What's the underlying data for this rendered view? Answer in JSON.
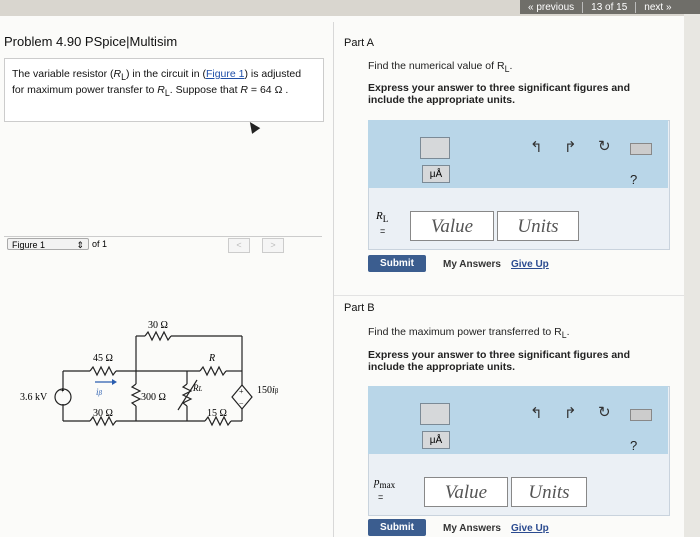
{
  "nav": {
    "previous": "« previous",
    "position": "13 of 15",
    "next": "next »"
  },
  "problem": {
    "title": "Problem 4.90 PSpice|Multisim",
    "text_a": "The variable resistor (",
    "text_rl": "R",
    "text_rl_sub": "L",
    "text_b": ") in the circuit in (",
    "figure_link": "Figure 1",
    "text_c": ") is adjusted for maximum power transfer to ",
    "text_d": ". Suppose that ",
    "text_r": "R",
    "text_e": " = 64  Ω ."
  },
  "figure": {
    "label": "Figure 1",
    "of": "of 1",
    "prev": "<",
    "next": ">"
  },
  "circuit": {
    "r_top": "30 Ω",
    "r_45": "45 Ω",
    "r_R": "R",
    "r_30": "30 Ω",
    "r_300": "300 Ω",
    "r_L": "R",
    "r_L_sub": "L",
    "r_15": "15 Ω",
    "source_v": "3.6 kV",
    "i_label": "i",
    "i_sub": "β",
    "dep_source": "150",
    "dep_sub": "β"
  },
  "partA": {
    "header": "Part A",
    "prompt": "Find the numerical value of R",
    "prompt_sub": "L",
    "prompt_end": ".",
    "instruction": "Express your answer to three significant figures and include the appropriate units.",
    "var": "R",
    "var_sub": "L",
    "eq": "=",
    "value_placeholder": "Value",
    "units_placeholder": "Units",
    "submit": "Submit",
    "my_answers": "My Answers",
    "give_up": "Give Up",
    "mu_label": "μÅ",
    "help": "?"
  },
  "partB": {
    "header": "Part B",
    "prompt": "Find the maximum power transferred to R",
    "prompt_sub": "L",
    "prompt_end": ".",
    "instruction": "Express your answer to three significant figures and include the appropriate units.",
    "var": "p",
    "var_sub": "max",
    "eq": "=",
    "value_placeholder": "Value",
    "units_placeholder": "Units",
    "submit": "Submit",
    "my_answers": "My Answers",
    "give_up": "Give Up",
    "mu_label": "μÅ",
    "help": "?"
  },
  "colors": {
    "submit_bg": "#3b5d8f",
    "toolbar_bg": "#b9d6e8",
    "link": "#1f4fa8"
  }
}
